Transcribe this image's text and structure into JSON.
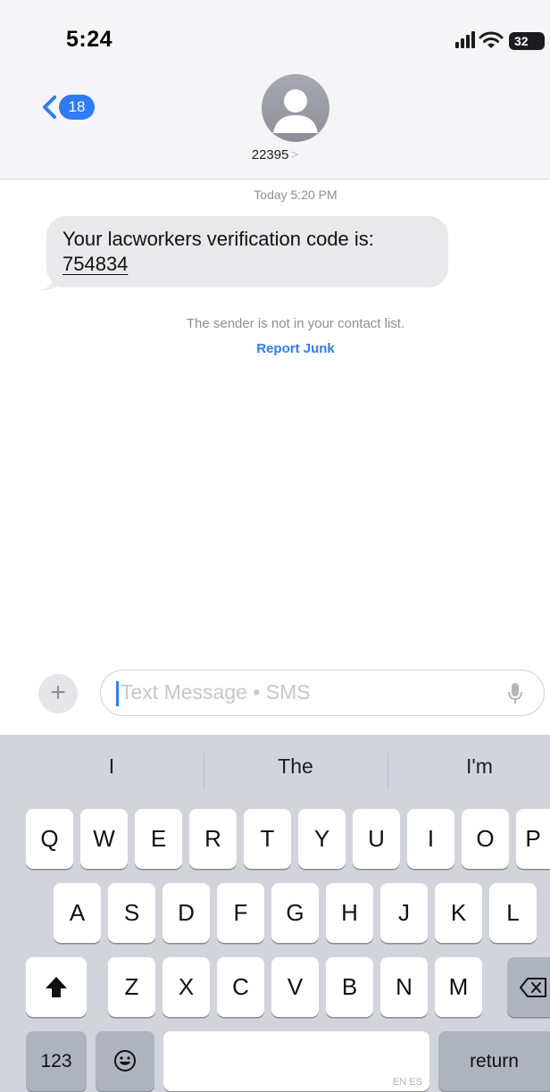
{
  "status_bar": {
    "time": "5:24",
    "battery": "32",
    "icons": [
      "signal-icon",
      "wifi-icon",
      "battery-icon"
    ]
  },
  "header": {
    "unread_count": "18",
    "contact": "22395",
    "contact_chevron": ">"
  },
  "conversation": {
    "timestamp": "Today 5:20 PM",
    "message_text": "Your lacworkers verification code is:",
    "message_code": "754834",
    "notice": "The sender is not in your contact list.",
    "report_junk": "Report Junk"
  },
  "input_bar": {
    "plus_label": "+",
    "placeholder": "Text Message • SMS"
  },
  "keyboard": {
    "suggestions": [
      "I",
      "The",
      "I'm"
    ],
    "row1": [
      "Q",
      "W",
      "E",
      "R",
      "T",
      "Y",
      "U",
      "I",
      "O",
      "P"
    ],
    "row2": [
      "A",
      "S",
      "D",
      "F",
      "G",
      "H",
      "J",
      "K",
      "L"
    ],
    "row3": [
      "Z",
      "X",
      "C",
      "V",
      "B",
      "N",
      "M"
    ],
    "numbers_label": "123",
    "space_hint": "EN ES",
    "return_label": "return"
  },
  "colors": {
    "accent": "#2f7cf6",
    "bubble": "#e9e9eb",
    "keyboard_bg": "#d1d4db"
  }
}
